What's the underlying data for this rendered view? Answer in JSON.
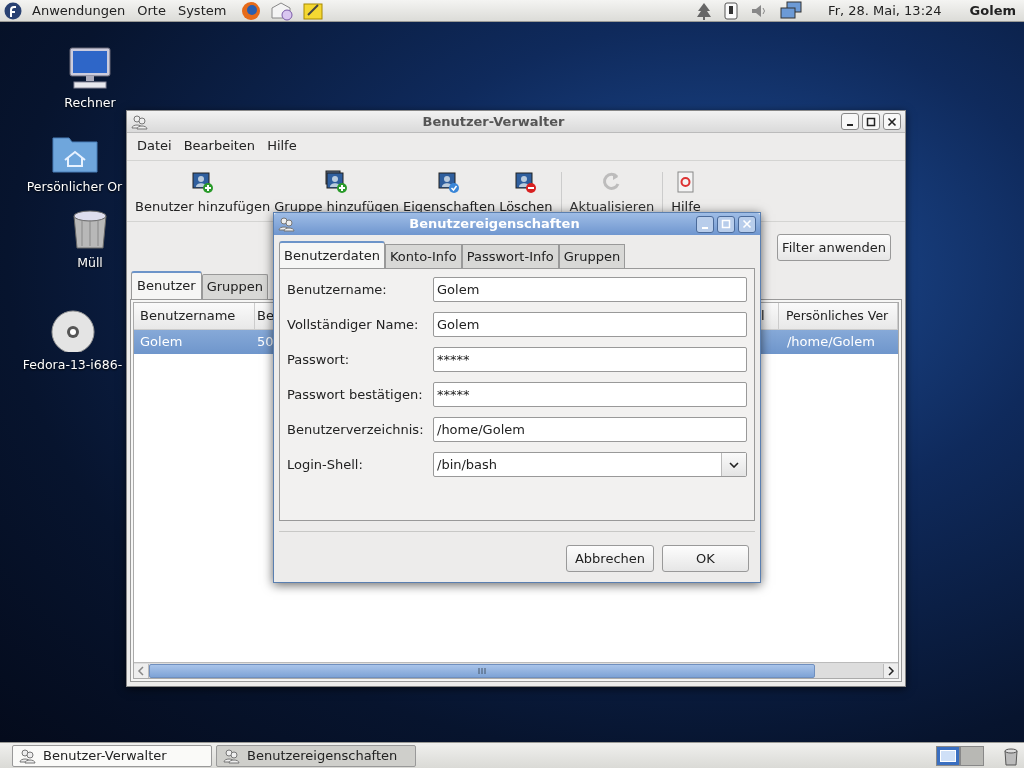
{
  "top_panel": {
    "menus": [
      "Anwendungen",
      "Orte",
      "System"
    ],
    "clock": "Fr, 28. Mai, 13:24",
    "user": "Golem"
  },
  "desktop_icons": [
    {
      "label": "Rechner",
      "kind": "computer"
    },
    {
      "label": "Persönlicher Or",
      "kind": "home"
    },
    {
      "label": "Müll",
      "kind": "trash"
    },
    {
      "label": "Fedora-13-i686-",
      "kind": "dvd"
    }
  ],
  "main_window": {
    "title": "Benutzer-Verwalter",
    "menu": [
      "Datei",
      "Bearbeiten",
      "Hilfe"
    ],
    "toolbar": [
      {
        "label": "Benutzer hinzufügen",
        "kind": "add-user",
        "disabled": false
      },
      {
        "label": "Gruppe hinzufügen",
        "kind": "add-group",
        "disabled": false
      },
      {
        "label": "Eigenschaften",
        "kind": "properties",
        "disabled": false
      },
      {
        "label": "Löschen",
        "kind": "delete",
        "disabled": false
      },
      {
        "label": "Aktualisieren",
        "kind": "refresh",
        "disabled": true
      },
      {
        "label": "Hilfe",
        "kind": "help",
        "disabled": false
      }
    ],
    "filter_button": "Filter anwenden",
    "tabs": [
      {
        "label": "Benutzer",
        "selected": true
      },
      {
        "label": "Gruppen",
        "selected": false
      }
    ],
    "table": {
      "columns": [
        "Benutzername",
        "Be",
        "l",
        "Persönliches Ver"
      ],
      "rows": [
        {
          "cells": [
            "Golem",
            "50",
            "",
            "/home/Golem"
          ],
          "selected": true
        }
      ]
    }
  },
  "dialog": {
    "title": "Benutzereigenschaften",
    "tabs": [
      {
        "label": "Benutzerdaten",
        "selected": true
      },
      {
        "label": "Konto-Info",
        "selected": false
      },
      {
        "label": "Passwort-Info",
        "selected": false
      },
      {
        "label": "Gruppen",
        "selected": false
      }
    ],
    "fields": [
      {
        "label": "Benutzername:",
        "value": "Golem",
        "kind": "text"
      },
      {
        "label": "Vollständiger Name:",
        "value": "Golem",
        "kind": "text"
      },
      {
        "label": "Passwort:",
        "value": "*****",
        "kind": "text"
      },
      {
        "label": "Passwort bestätigen:",
        "value": "*****",
        "kind": "text"
      },
      {
        "label": "Benutzerverzeichnis:",
        "value": "/home/Golem",
        "kind": "text"
      },
      {
        "label": "Login-Shell:",
        "value": "/bin/bash",
        "kind": "combo"
      }
    ],
    "buttons": [
      "Abbrechen",
      "OK"
    ]
  },
  "taskbar": {
    "tasks": [
      {
        "label": "Benutzer-Verwalter",
        "selected": false
      },
      {
        "label": "Benutzereigenschaften",
        "selected": true
      }
    ],
    "workspaces": [
      {
        "selected": true
      },
      {
        "selected": false
      }
    ]
  }
}
